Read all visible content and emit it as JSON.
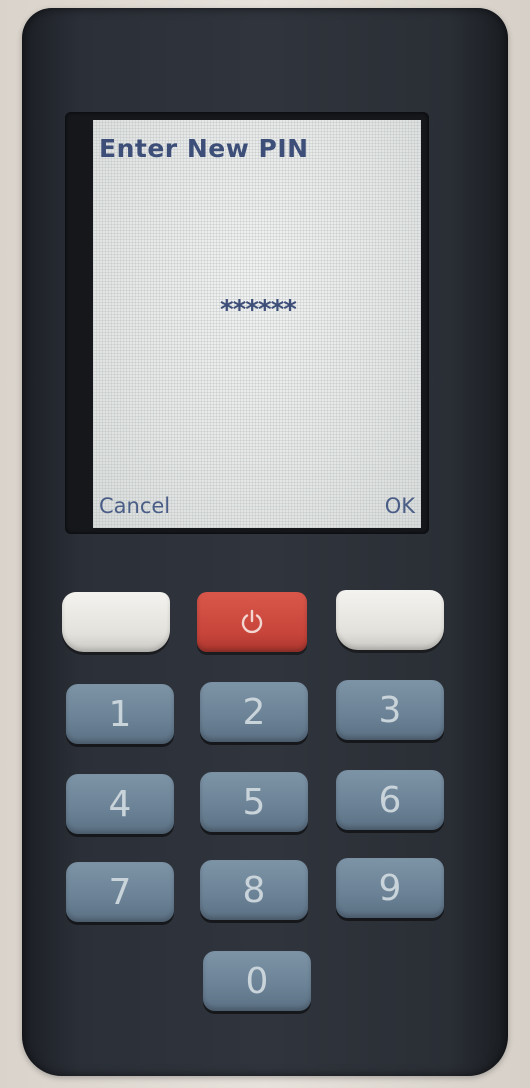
{
  "screen": {
    "title": "Enter New PIN",
    "pin_mask": "******",
    "softkeys": {
      "left_label": "Cancel",
      "right_label": "OK"
    }
  },
  "keypad": {
    "power_icon": "power-icon",
    "keys": [
      "1",
      "2",
      "3",
      "4",
      "5",
      "6",
      "7",
      "8",
      "9",
      "0"
    ]
  },
  "colors": {
    "screen_text": "#3d4f79",
    "device_body": "#2b2f37",
    "number_keys": "#6b8296",
    "power_key": "#c7443a",
    "soft_keys": "#e2e1dc"
  }
}
